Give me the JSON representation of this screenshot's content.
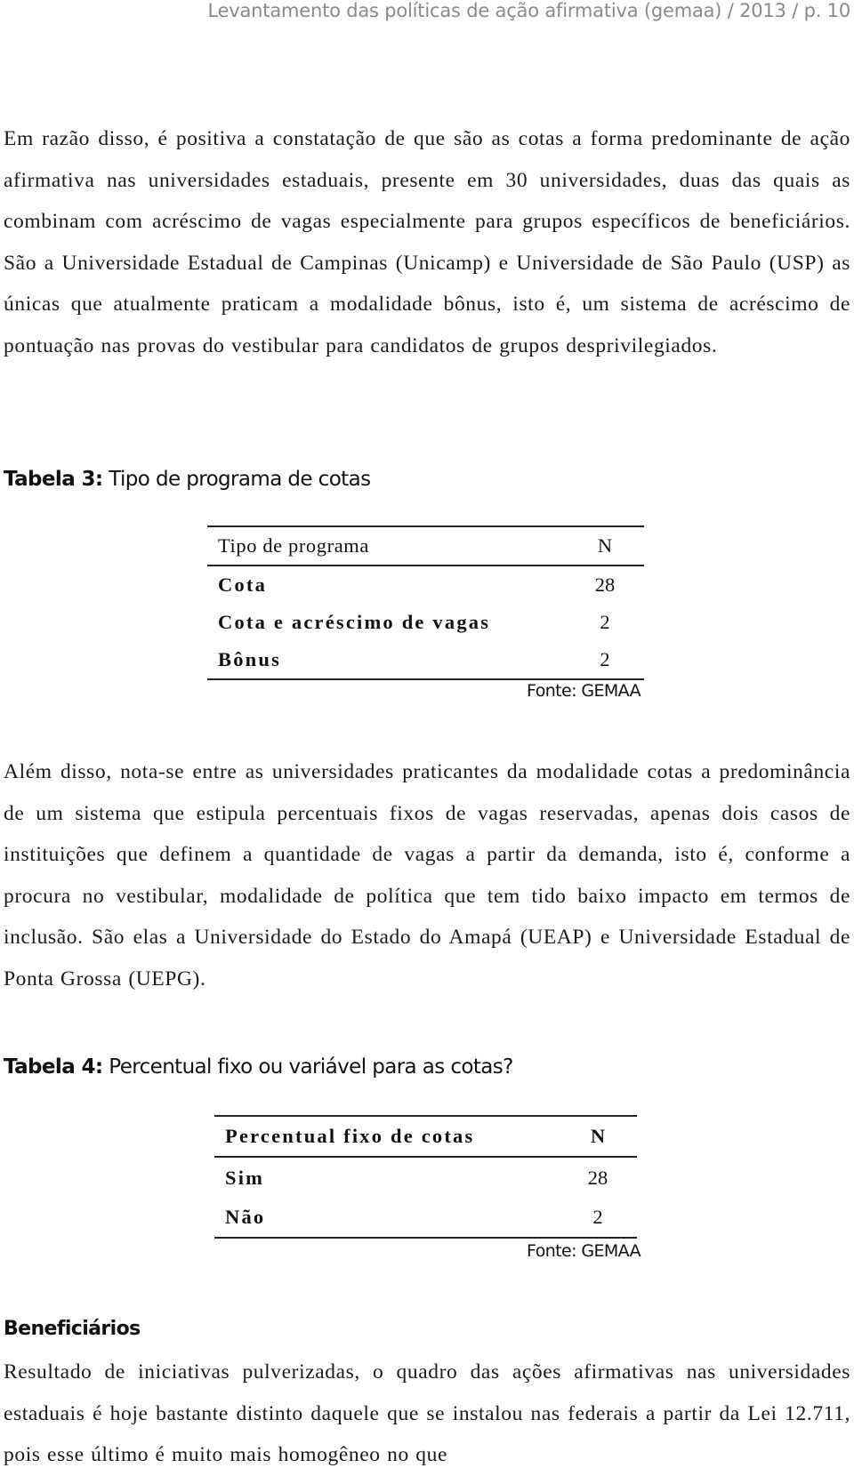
{
  "running_head": "Levantamento das políticas de ação afirmativa (gemaa) / 2013 / p. 10",
  "paragraphs": {
    "p1": "Em razão disso, é positiva a constatação de que são as cotas a forma predominante de ação afirmativa nas universidades estaduais, presente em 30 universidades, duas das quais as combinam com acréscimo de vagas especialmente para grupos específicos de beneficiários. São a Universidade Estadual de Campinas (Unicamp) e Universidade de São Paulo (USP) as únicas que atualmente praticam a modalidade bônus, isto é, um sistema de acréscimo de pontuação nas provas do vestibular para candidatos de grupos desprivilegiados.",
    "p2": "Além disso, nota-se entre as universidades praticantes da modalidade cotas a predominância de um sistema que estipula percentuais fixos de vagas reservadas, apenas dois casos de instituições que definem a quantidade de vagas a partir da demanda, isto é, conforme a procura no vestibular, modalidade de política que tem tido baixo impacto em termos de inclusão. São elas a Universidade do Estado do Amapá (UEAP) e Universidade Estadual de Ponta Grossa (UEPG).",
    "p3": "Resultado de iniciativas pulverizadas, o quadro das ações afirmativas nas universidades estaduais é hoje bastante distinto daquele que se instalou nas federais a partir da Lei 12.711, pois esse último é muito mais homogêneo no que"
  },
  "table3": {
    "caption_label": "Tabela 3:",
    "caption_text": " Tipo de programa de cotas",
    "headers": [
      "Tipo de programa",
      "N"
    ],
    "rows": [
      {
        "label": "Cota",
        "n": "28"
      },
      {
        "label": "Cota e acréscimo de vagas",
        "n": "2"
      },
      {
        "label": "Bônus",
        "n": "2"
      }
    ],
    "source": "Fonte: GEMAA"
  },
  "table4": {
    "caption_label": "Tabela 4:",
    "caption_text": " Percentual fixo ou variável para as cotas?",
    "headers": [
      "Percentual fixo de cotas",
      "N"
    ],
    "rows": [
      {
        "label": "Sim",
        "n": "28"
      },
      {
        "label": "Não",
        "n": "2"
      }
    ],
    "source": "Fonte: GEMAA"
  },
  "section_heading": "Beneficiários"
}
